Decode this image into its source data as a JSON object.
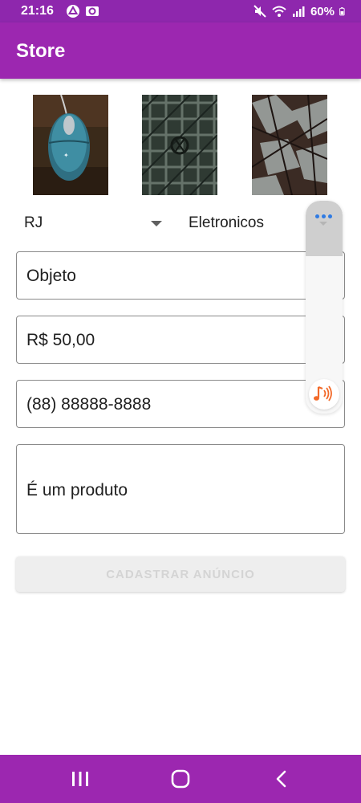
{
  "status_bar": {
    "time": "21:16",
    "battery": "60%",
    "icons": [
      "drive-icon",
      "camera-icon",
      "mute-icon",
      "wifi-icon",
      "signal-icon",
      "battery-icon"
    ]
  },
  "app_bar": {
    "title": "Store"
  },
  "photos": [
    {
      "name": "photo-mouse"
    },
    {
      "name": "photo-pattern"
    },
    {
      "name": "photo-fabric"
    }
  ],
  "form": {
    "state": "RJ",
    "category": "Eletronicos",
    "title_value": "Objeto",
    "price_value": "R$ 50,00",
    "phone_value": "(88) 88888-8888",
    "description_value": "É um produto",
    "submit_label": "CADASTRAR ANÚNCIO"
  },
  "overlay": {
    "icons": [
      "more-dots-icon",
      "chevron-down-icon",
      "music-sound-icon"
    ]
  },
  "nav_bar": {
    "icons": [
      "recents-icon",
      "home-icon",
      "back-icon"
    ]
  },
  "colors": {
    "status_bar": "#8e27ad",
    "app_bar": "#9c27b0",
    "nav_bar": "#9c27b0",
    "button_bg": "#eeeeee",
    "button_text_disabled": "#d4d4d4",
    "overlay_dots": "#2f7be3",
    "overlay_sound": "#f26a2a"
  }
}
